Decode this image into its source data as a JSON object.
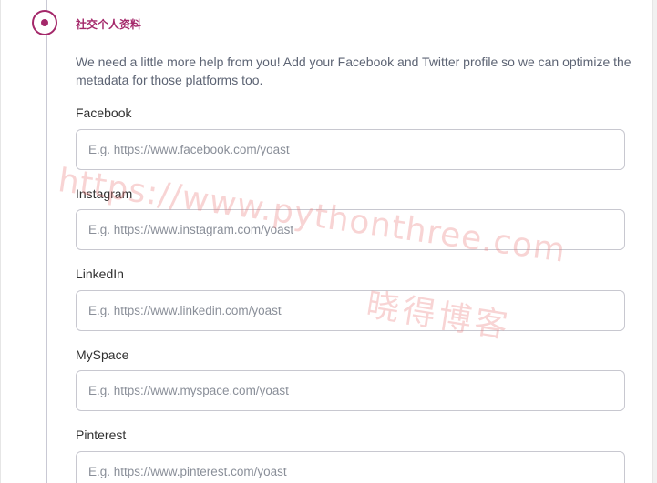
{
  "step": {
    "title": "社交个人资料",
    "description": "We need a little more help from you! Add your Facebook and Twitter profile so we can optimize the metadata for those platforms too."
  },
  "fields": [
    {
      "label": "Facebook",
      "value": "",
      "placeholder": "E.g. https://www.facebook.com/yoast"
    },
    {
      "label": "Instagram",
      "value": "",
      "placeholder": "E.g. https://www.instagram.com/yoast"
    },
    {
      "label": "LinkedIn",
      "value": "",
      "placeholder": "E.g. https://www.linkedin.com/yoast"
    },
    {
      "label": "MySpace",
      "value": "",
      "placeholder": "E.g. https://www.myspace.com/yoast"
    },
    {
      "label": "Pinterest",
      "value": "",
      "placeholder": "E.g. https://www.pinterest.com/yoast"
    }
  ],
  "watermark": {
    "url": "https://www.pythonthree.com",
    "name": "晓得博客"
  },
  "colors": {
    "accent": "#a4286a",
    "timeline": "#c9c9d4",
    "input_border": "#c8c8d0",
    "watermark": "#e97878"
  }
}
